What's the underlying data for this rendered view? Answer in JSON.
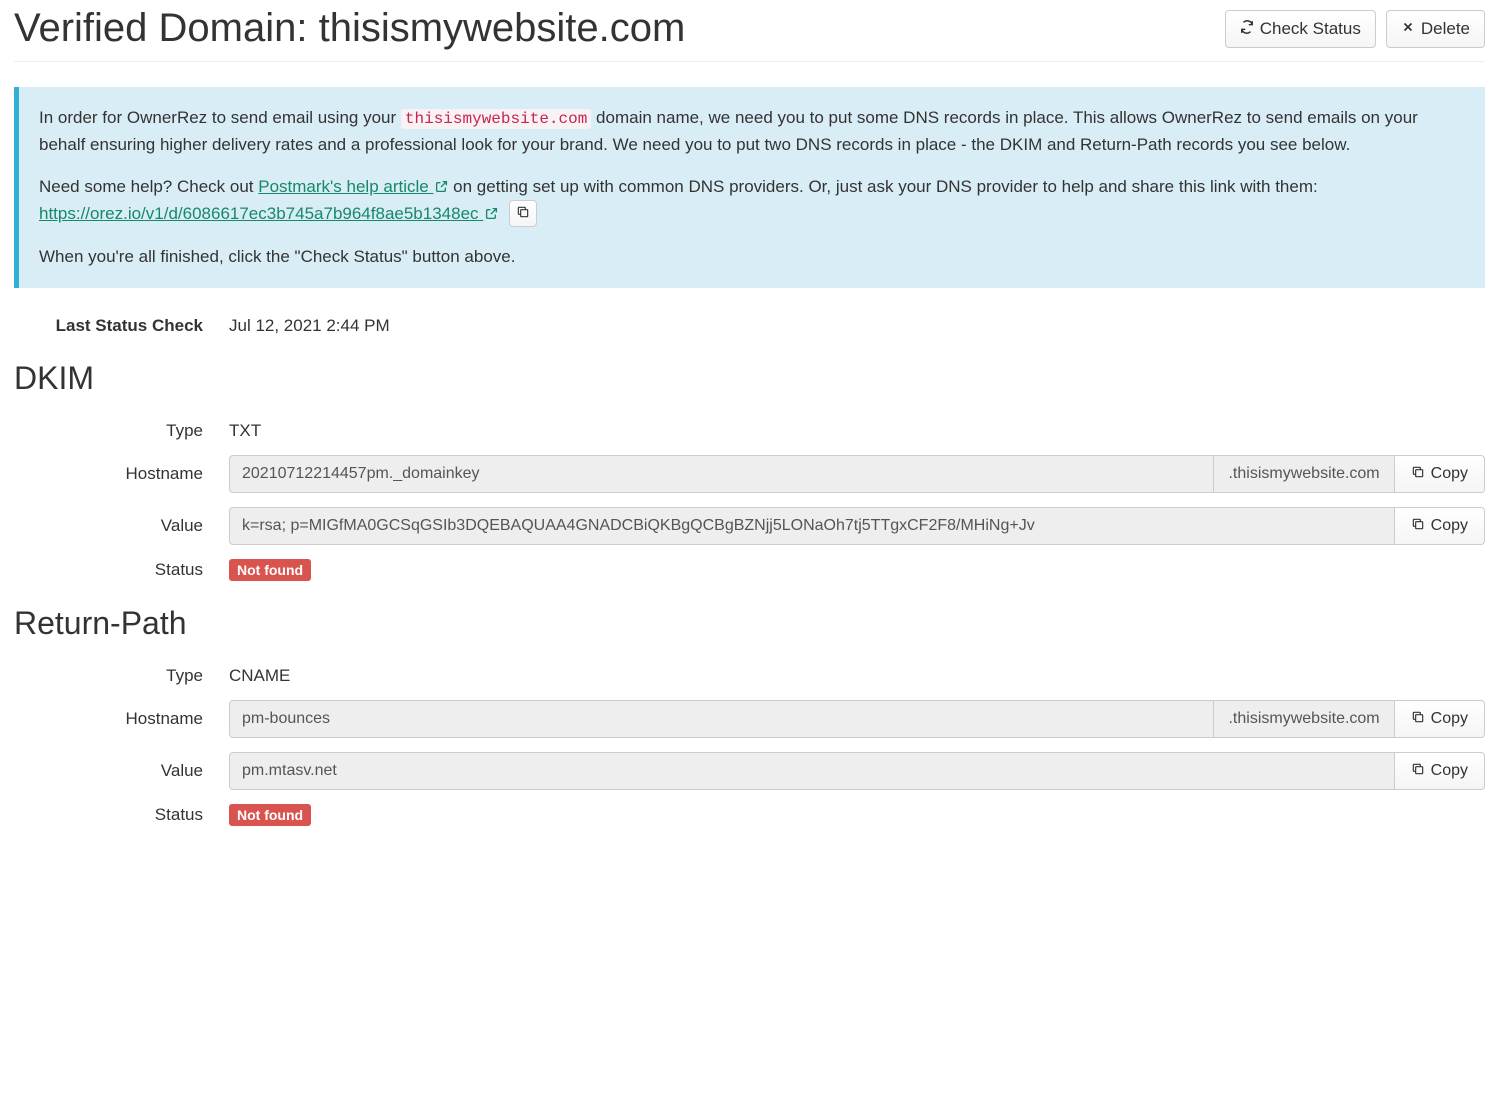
{
  "header": {
    "title": "Verified Domain: thisismywebsite.com",
    "check_status_label": "Check Status",
    "delete_label": "Delete"
  },
  "alert": {
    "p1_pre": "In order for OwnerRez to send email using your ",
    "p1_code": "thisismywebsite.com",
    "p1_post": " domain name, we need you to put some DNS records in place. This allows OwnerRez to send emails on your behalf ensuring higher delivery rates and a professional look for your brand. We need you to put two DNS records in place - the DKIM and Return-Path records you see below.",
    "p2_pre": "Need some help? Check out ",
    "p2_link1": "Postmark's help article ",
    "p2_mid": " on getting set up with common DNS providers. Or, just ask your DNS provider to help and share this link with them: ",
    "p2_link2": "https://orez.io/v1/d/6086617ec3b745a7b964f8ae5b1348ec ",
    "p3": "When you're all finished, click the \"Check Status\" button above."
  },
  "status": {
    "label": "Last Status Check",
    "value": "Jul 12, 2021 2:44 PM"
  },
  "labels": {
    "type": "Type",
    "hostname": "Hostname",
    "value": "Value",
    "status": "Status",
    "copy": "Copy"
  },
  "dkim": {
    "heading": "DKIM",
    "type": "TXT",
    "hostname": "20210712214457pm._domainkey",
    "hostname_suffix": ".thisismywebsite.com",
    "value": "k=rsa; p=MIGfMA0GCSqGSIb3DQEBAQUAA4GNADCBiQKBgQCBgBZNjj5LONaOh7tj5TTgxCF2F8/MHiNg+Jv",
    "status": "Not found"
  },
  "returnpath": {
    "heading": "Return-Path",
    "type": "CNAME",
    "hostname": "pm-bounces",
    "hostname_suffix": ".thisismywebsite.com",
    "value": "pm.mtasv.net",
    "status": "Not found"
  }
}
